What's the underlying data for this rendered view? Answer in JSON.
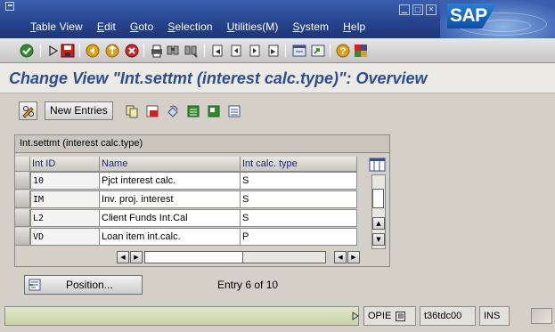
{
  "menubar": {
    "items": [
      "Table View",
      "Edit",
      "Goto",
      "Selection",
      "Utilities(M)",
      "System",
      "Help"
    ],
    "logo": "SAP"
  },
  "toolbar": {
    "icons": [
      "enter-icon",
      "command-field-icon",
      "save-icon",
      "back-icon",
      "exit-icon",
      "cancel-icon",
      "print-icon",
      "find-icon",
      "find-next-icon",
      "first-page-icon",
      "previous-page-icon",
      "next-page-icon",
      "last-page-icon",
      "create-session-icon",
      "shortcut-icon",
      "help-icon",
      "customize-layout-icon"
    ]
  },
  "screen": {
    "title": "Change View \"Int.settmt (interest calc.type)\": Overview"
  },
  "appbar": {
    "new_entries": "New Entries"
  },
  "table": {
    "caption": "Int.settmt (interest calc.type)",
    "columns": [
      "Int ID",
      "Name",
      "Int calc. type"
    ],
    "rows": [
      {
        "id": "10",
        "name": "Pjct interest calc.",
        "type": "S"
      },
      {
        "id": "IM",
        "name": "Inv. proj. interest",
        "type": "S"
      },
      {
        "id": "L2",
        "name": "Client Funds Int.Cal",
        "type": "S"
      },
      {
        "id": "VD",
        "name": "Loan item int.calc.",
        "type": "P"
      }
    ]
  },
  "position": {
    "button": "Position...",
    "entry": "Entry 6 of 10"
  },
  "status": {
    "system": "OPIE",
    "client": "t36tdc00",
    "mode": "INS"
  },
  "colors": {
    "title_blue": "#2c4d8f",
    "menubar_blue": "#27458f",
    "status_green": "#d3ddb8"
  }
}
